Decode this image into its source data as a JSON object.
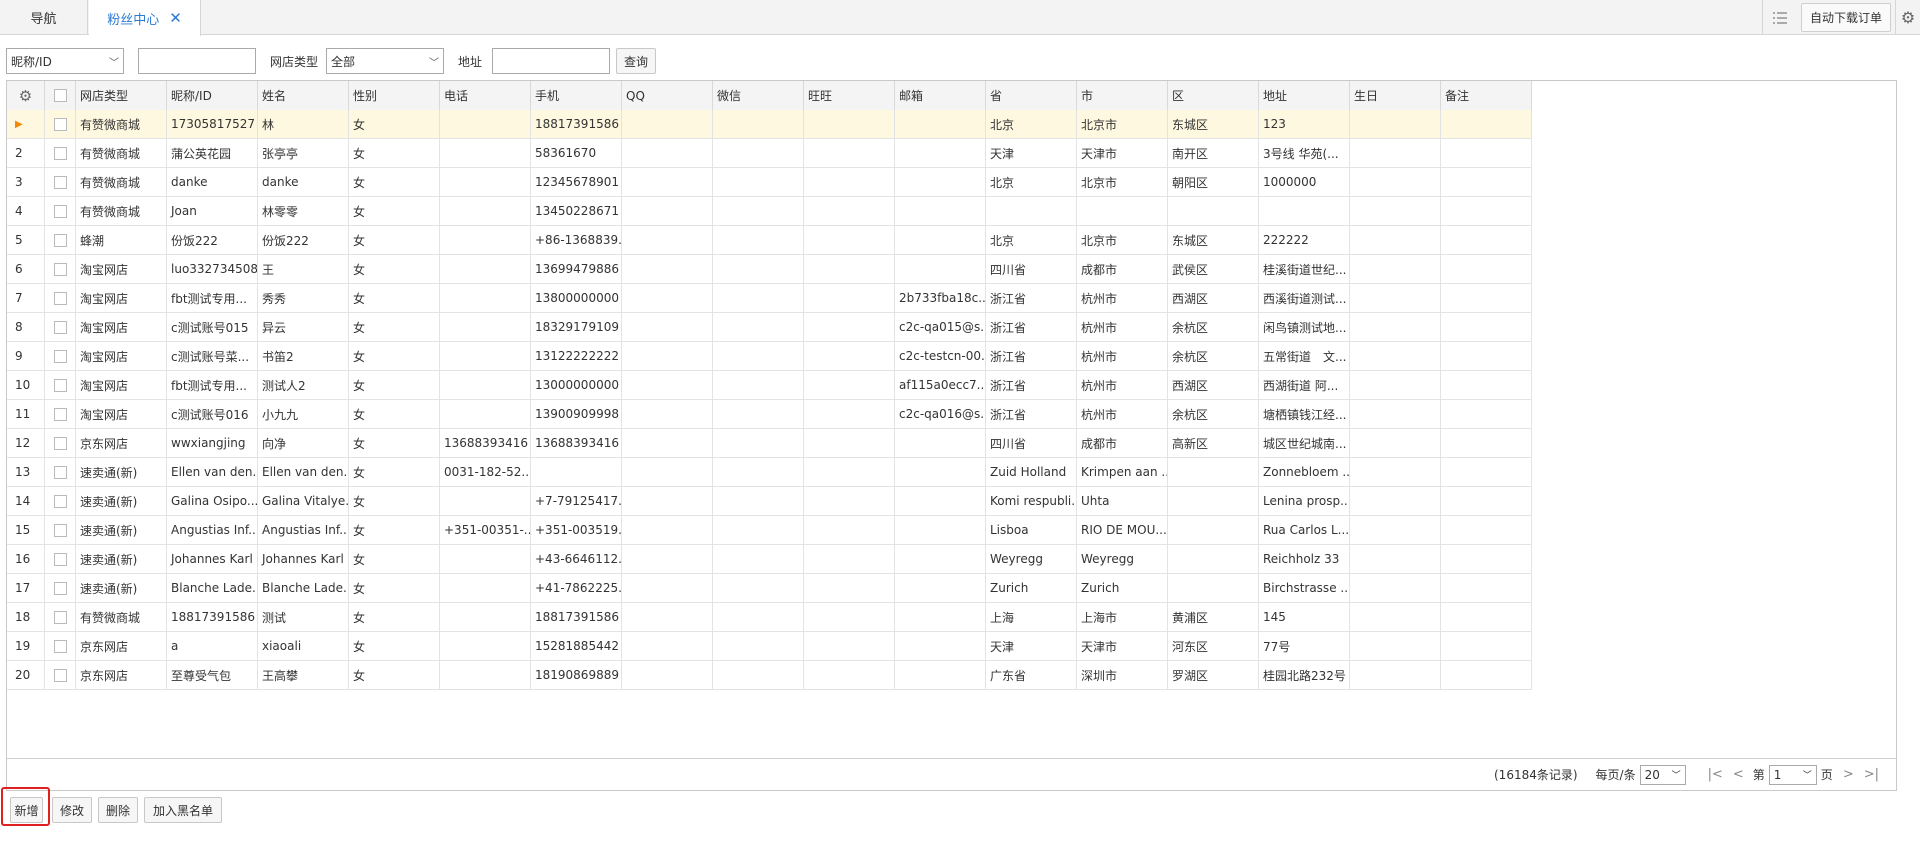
{
  "tabs": {
    "nav": "导航",
    "fans": "粉丝中心"
  },
  "topright": {
    "auto_download": "自动下载订单"
  },
  "filter": {
    "field_select": "昵称/ID",
    "shop_type_label": "网店类型",
    "shop_type_value": "全部",
    "address_label": "地址",
    "query_button": "查询"
  },
  "columns": [
    "网店类型",
    "昵称/ID",
    "姓名",
    "性别",
    "电话",
    "手机",
    "QQ",
    "微信",
    "旺旺",
    "邮箱",
    "省",
    "市",
    "区",
    "地址",
    "生日",
    "备注"
  ],
  "rows": [
    [
      "1",
      "有赞微商城",
      "17305817527",
      "林",
      "女",
      "",
      "18817391586",
      "",
      "",
      "",
      "",
      "北京",
      "北京市",
      "东城区",
      "123",
      "",
      ""
    ],
    [
      "2",
      "有赞微商城",
      "蒲公英花园",
      "张亭亭",
      "女",
      "",
      "58361670",
      "",
      "",
      "",
      "",
      "天津",
      "天津市",
      "南开区",
      "3号线 华苑(...",
      "",
      ""
    ],
    [
      "3",
      "有赞微商城",
      "danke",
      "danke",
      "女",
      "",
      "12345678901",
      "",
      "",
      "",
      "",
      "北京",
      "北京市",
      "朝阳区",
      "1000000",
      "",
      ""
    ],
    [
      "4",
      "有赞微商城",
      "Joan",
      "林零零",
      "女",
      "",
      "13450228671",
      "",
      "",
      "",
      "",
      "",
      "",
      "",
      "",
      "",
      ""
    ],
    [
      "5",
      "蜂潮",
      "份饭222",
      "份饭222",
      "女",
      "",
      "+86-1368839...",
      "",
      "",
      "",
      "",
      "北京",
      "北京市",
      "东城区",
      "222222",
      "",
      ""
    ],
    [
      "6",
      "淘宝网店",
      "luo332734508",
      "王",
      "女",
      "",
      "13699479886",
      "",
      "",
      "",
      "",
      "四川省",
      "成都市",
      "武侯区",
      "桂溪街道世纪...",
      "",
      ""
    ],
    [
      "7",
      "淘宝网店",
      "fbt测试专用...",
      "秀秀",
      "女",
      "",
      "13800000000",
      "",
      "",
      "",
      "2b733fba18c...",
      "浙江省",
      "杭州市",
      "西湖区",
      "西溪街道测试...",
      "",
      ""
    ],
    [
      "8",
      "淘宝网店",
      "c测试账号015",
      "异云",
      "女",
      "",
      "18329179109",
      "",
      "",
      "",
      "c2c-qa015@s...",
      "浙江省",
      "杭州市",
      "余杭区",
      "闲鸟镇测试地...",
      "",
      ""
    ],
    [
      "9",
      "淘宝网店",
      "c测试账号菜...",
      "书笛2",
      "女",
      "",
      "13122222222",
      "",
      "",
      "",
      "c2c-testcn-00...",
      "浙江省",
      "杭州市",
      "余杭区",
      "五常街道　文...",
      "",
      ""
    ],
    [
      "10",
      "淘宝网店",
      "fbt测试专用...",
      "测试人2",
      "女",
      "",
      "13000000000",
      "",
      "",
      "",
      "af115a0ecc7...",
      "浙江省",
      "杭州市",
      "西湖区",
      "西湖街道 阿...",
      "",
      ""
    ],
    [
      "11",
      "淘宝网店",
      "c测试账号016",
      "小九九",
      "女",
      "",
      "13900909998",
      "",
      "",
      "",
      "c2c-qa016@s...",
      "浙江省",
      "杭州市",
      "余杭区",
      "塘栖镇钱江经...",
      "",
      ""
    ],
    [
      "12",
      "京东网店",
      "wwxiangjing",
      "向净",
      "女",
      "13688393416",
      "13688393416",
      "",
      "",
      "",
      "",
      "四川省",
      "成都市",
      "高新区",
      "城区世纪城南...",
      "",
      ""
    ],
    [
      "13",
      "速卖通(新)",
      "Ellen van den...",
      "Ellen van den...",
      "女",
      "0031-182-52...",
      "",
      "",
      "",
      "",
      "",
      "Zuid Holland",
      "Krimpen aan ...",
      "",
      "Zonnebloem ...",
      "",
      ""
    ],
    [
      "14",
      "速卖通(新)",
      "Galina Osipo...",
      "Galina Vitalye...",
      "女",
      "",
      "+7-79125417...",
      "",
      "",
      "",
      "",
      "Komi respubli...",
      "Uhta",
      "",
      "Lenina prosp...",
      "",
      ""
    ],
    [
      "15",
      "速卖通(新)",
      "Angustias Inf...",
      "Angustias Inf...",
      "女",
      "+351-00351-...",
      "+351-003519...",
      "",
      "",
      "",
      "",
      "Lisboa",
      "RIO DE MOU...",
      "",
      "Rua Carlos L...",
      "",
      ""
    ],
    [
      "16",
      "速卖通(新)",
      "Johannes Karl",
      "Johannes Karl",
      "女",
      "",
      "+43-6646112...",
      "",
      "",
      "",
      "",
      "Weyregg",
      "Weyregg",
      "",
      "Reichholz 33",
      "",
      ""
    ],
    [
      "17",
      "速卖通(新)",
      "Blanche Lade...",
      "Blanche Lade...",
      "女",
      "",
      "+41-7862225...",
      "",
      "",
      "",
      "",
      "Zurich",
      "Zurich",
      "",
      "Birchstrasse ...",
      "",
      ""
    ],
    [
      "18",
      "有赞微商城",
      "18817391586",
      "测试",
      "女",
      "",
      "18817391586",
      "",
      "",
      "",
      "",
      "上海",
      "上海市",
      "黄浦区",
      "145",
      "",
      ""
    ],
    [
      "19",
      "京东网店",
      "a",
      "xiaoali",
      "女",
      "",
      "15281885442",
      "",
      "",
      "",
      "",
      "天津",
      "天津市",
      "河东区",
      "77号",
      "",
      ""
    ],
    [
      "20",
      "京东网店",
      "至尊受气包",
      "王高攀",
      "女",
      "",
      "18190869889",
      "",
      "",
      "",
      "",
      "广东省",
      "深圳市",
      "罗湖区",
      "桂园北路232号",
      "",
      ""
    ]
  ],
  "pager": {
    "records": "(16184条记录)",
    "per_page_label": "每页/条",
    "per_page_value": "20",
    "page_prefix": "第",
    "page_value": "1",
    "page_suffix": "页"
  },
  "actions": {
    "add": "新增",
    "edit": "修改",
    "delete": "删除",
    "blacklist": "加入黑名单"
  }
}
